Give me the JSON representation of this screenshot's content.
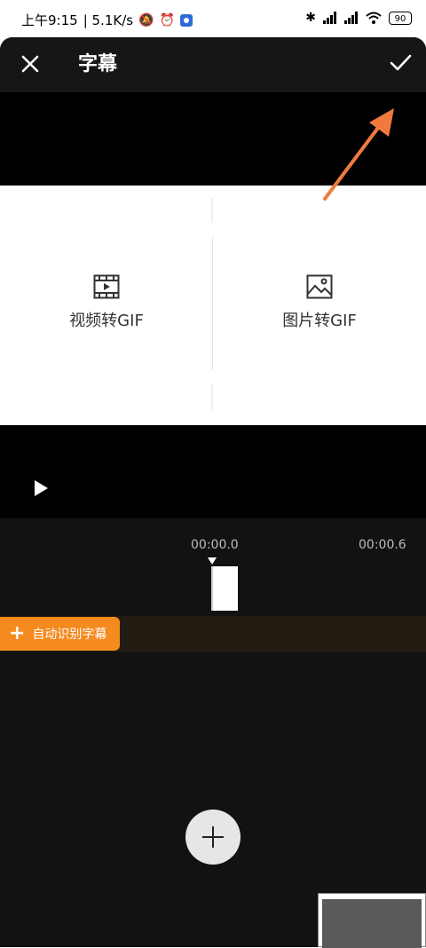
{
  "status_bar": {
    "time": "上午9:15",
    "network_speed": "| 5.1K/s",
    "battery": "90"
  },
  "header": {
    "title": "字幕"
  },
  "preview": {
    "option_left": "视频转GIF",
    "option_right": "图片转GIF"
  },
  "timeline": {
    "time_current": "00:00.0",
    "time_next": "00:00.6",
    "auto_caption_label": "自动识别字幕"
  },
  "colors": {
    "accent": "#f58a1f",
    "arrow": "#f07a3e",
    "background": "#101010"
  }
}
